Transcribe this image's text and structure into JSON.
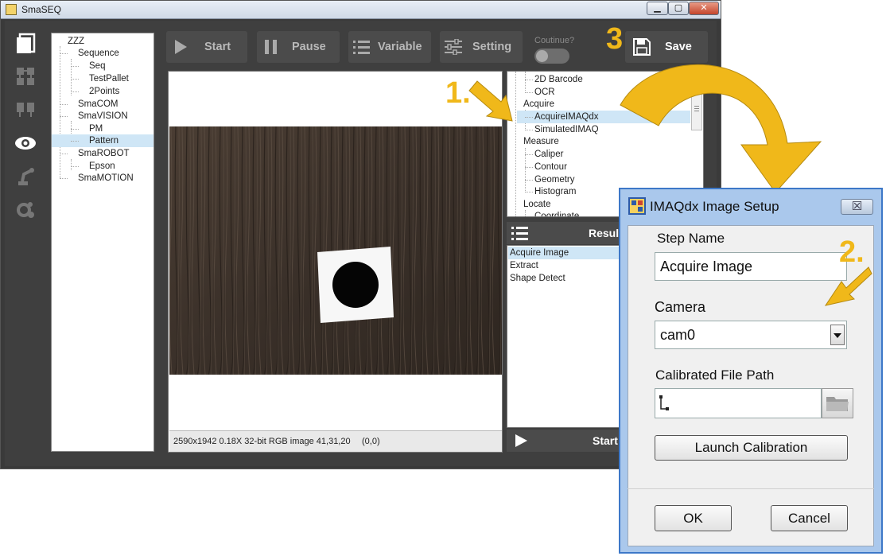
{
  "window": {
    "title": "SmaSEQ"
  },
  "tree": {
    "items": [
      {
        "label": "ZZZ",
        "level": 0
      },
      {
        "label": "Sequence",
        "level": 1
      },
      {
        "label": "Seq",
        "level": 2
      },
      {
        "label": "TestPallet",
        "level": 2
      },
      {
        "label": "2Points",
        "level": 2
      },
      {
        "label": "SmaCOM",
        "level": 1
      },
      {
        "label": "SmaVISION",
        "level": 1
      },
      {
        "label": "PM",
        "level": 2
      },
      {
        "label": "Pattern",
        "level": 2,
        "selected": true
      },
      {
        "label": "SmaROBOT",
        "level": 1
      },
      {
        "label": "Epson",
        "level": 2
      },
      {
        "label": "SmaMOTION",
        "level": 1
      }
    ]
  },
  "toolbar": {
    "start": "Start",
    "pause": "Pause",
    "variable": "Variable",
    "setting": "Setting",
    "continue_label": "Coutinue?",
    "save": "Save"
  },
  "image_view": {
    "status": "2590x1942 0.18X 32-bit RGB image 41,31,20",
    "coords": "(0,0)"
  },
  "tools": {
    "items": [
      {
        "label": "2D Barcode",
        "level": 2
      },
      {
        "label": "OCR",
        "level": 2
      },
      {
        "label": "Acquire",
        "level": 1
      },
      {
        "label": "AcquireIMAQdx",
        "level": 2,
        "selected": true
      },
      {
        "label": "SimulatedIMAQ",
        "level": 2
      },
      {
        "label": "Measure",
        "level": 1
      },
      {
        "label": "Caliper",
        "level": 2
      },
      {
        "label": "Contour",
        "level": 2
      },
      {
        "label": "Geometry",
        "level": 2
      },
      {
        "label": "Histogram",
        "level": 2
      },
      {
        "label": "Locate",
        "level": 1
      },
      {
        "label": "Coordinate",
        "level": 2
      }
    ]
  },
  "results": {
    "header": "Result",
    "items": [
      {
        "label": "Acquire Image",
        "selected": true
      },
      {
        "label": "Extract"
      },
      {
        "label": "Shape Detect"
      }
    ],
    "start": "Start"
  },
  "annotations": {
    "step1": "1.",
    "step2": "2.",
    "step3": "3"
  },
  "dialog": {
    "title": "IMAQdx Image Setup",
    "close": "☒",
    "step_name_label": "Step Name",
    "step_name_value": "Acquire Image",
    "camera_label": "Camera",
    "camera_value": "cam0",
    "calib_label": "Calibrated File Path",
    "calib_value": "",
    "launch": "Launch Calibration",
    "ok": "OK",
    "cancel": "Cancel"
  },
  "colors": {
    "accent": "#f0b81a",
    "panel": "#4b4b4b",
    "selection": "#cfe6f6",
    "dialog_border": "#3d78c8"
  }
}
